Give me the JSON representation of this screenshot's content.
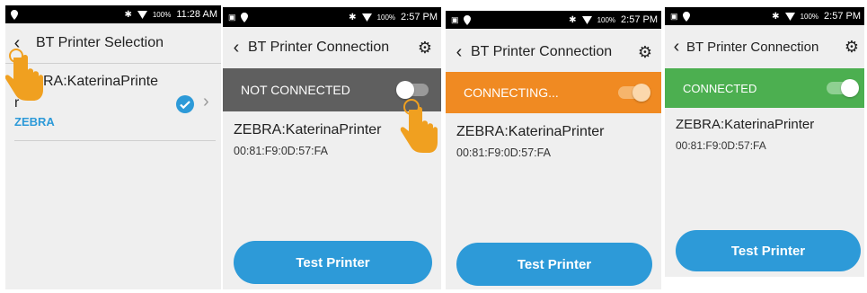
{
  "colors": {
    "accent": "#2d9ad8",
    "not_connected_bar": "#5f5f5f",
    "connecting_bar": "#f08a22",
    "connected_bar": "#4caf50",
    "status_bar": "#000000",
    "background": "#efefef",
    "brand": "#2d9ad8"
  },
  "screens": [
    {
      "status": {
        "battery": "100%",
        "time": "11:28 AM"
      },
      "title": "BT Printer Selection",
      "printer_name": "RA:KaterinaPrinte",
      "printer_name_wrap": "r",
      "brand": "ZEBRA"
    },
    {
      "status": {
        "battery": "100%",
        "time": "2:57 PM"
      },
      "title": "BT Printer Connection",
      "connection_state": "NOT CONNECTED",
      "device_name": "ZEBRA:KaterinaPrinter",
      "device_mac": "00:81:F9:0D:57:FA",
      "button": "Test Printer"
    },
    {
      "status": {
        "battery": "100%",
        "time": "2:57 PM"
      },
      "title": "BT Printer Connection",
      "connection_state": "CONNECTING...",
      "device_name": "ZEBRA:KaterinaPrinter",
      "device_mac": "00:81:F9:0D:57:FA",
      "button": "Test Printer"
    },
    {
      "status": {
        "battery": "100%",
        "time": "2:57 PM"
      },
      "title": "BT Printer Connection",
      "connection_state": "CONNECTED",
      "device_name": "ZEBRA:KaterinaPrinter",
      "device_mac": "00:81:F9:0D:57:FA",
      "button": "Test Printer"
    }
  ]
}
